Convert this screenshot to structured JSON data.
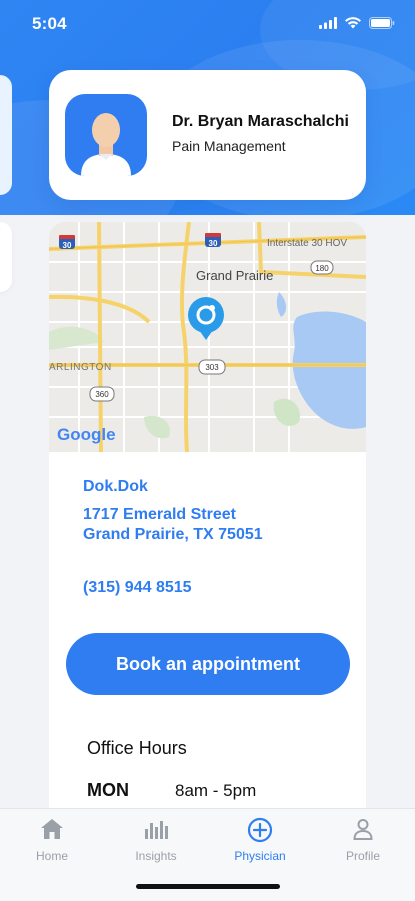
{
  "status_bar": {
    "time": "5:04",
    "icons": [
      "signal-icon",
      "wifi-icon",
      "battery-icon"
    ]
  },
  "doctor": {
    "name": "Dr. Bryan Maraschalchi",
    "specialty": "Pain Management",
    "avatar_icon": "person-avatar-icon"
  },
  "map": {
    "labels": {
      "interstate_top": "Interstate 30 HOV",
      "shield_30a": "30",
      "shield_30b": "30",
      "route_180": "180",
      "city": "Grand Prairie",
      "arlington": "ARLINGTON",
      "route_360": "360",
      "route_303": "303",
      "google": "Google"
    },
    "pin_icon": "location-pin-icon"
  },
  "clinic": {
    "name": "Dok.Dok",
    "address_line1": "1717 Emerald Street",
    "address_line2": "Grand Prairie, TX 75051",
    "phone": "(315) 944 8515"
  },
  "book_button_label": "Book an appointment",
  "office_hours": {
    "title": "Office Hours",
    "rows": [
      {
        "day": "MON",
        "hours": "8am - 5pm"
      }
    ]
  },
  "tabs": [
    {
      "label": "Home",
      "icon": "home-icon",
      "active": false
    },
    {
      "label": "Insights",
      "icon": "bar-chart-icon",
      "active": false
    },
    {
      "label": "Physician",
      "icon": "plus-circle-icon",
      "active": true
    },
    {
      "label": "Profile",
      "icon": "user-icon",
      "active": false
    }
  ],
  "colors": {
    "accent": "#2f7df1",
    "tab_inactive": "#9aa0a8",
    "hero": "#2f86f3"
  }
}
